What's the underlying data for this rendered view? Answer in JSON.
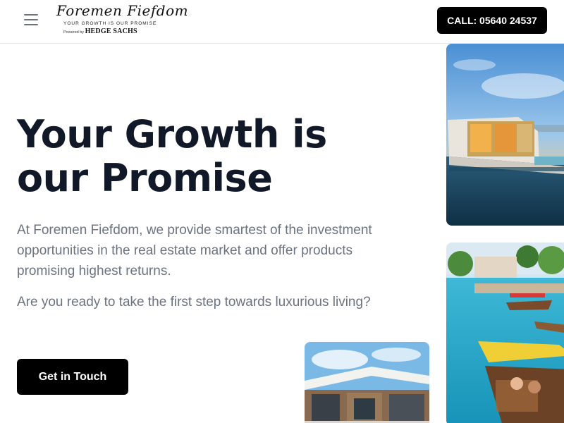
{
  "header": {
    "logo_script": "Foremen Fiefdom",
    "logo_tagline": "YOUR GROWTH IS OUR PROMISE",
    "logo_powered": "Powered by",
    "logo_brand": "HEDGE SACHS",
    "call_label": "CALL: 05640 24537"
  },
  "hero": {
    "title_line1": "Your Growth is",
    "title_line2": "our Promise",
    "description": "At Foremen Fiefdom, we provide smartest of the investment opportunities in the real estate market and offer products promising highest returns.",
    "question": "Are you ready to take the first step towards luxurious living?",
    "cta_label": "Get in Touch"
  },
  "images": {
    "floating_villa": "floating-villa-photo",
    "canal_boats": "canal-boats-photo",
    "modern_villa": "modern-villa-photo"
  },
  "colors": {
    "title": "#111827",
    "body_text": "#6b7280",
    "button_bg": "#000000",
    "button_text": "#ffffff"
  }
}
